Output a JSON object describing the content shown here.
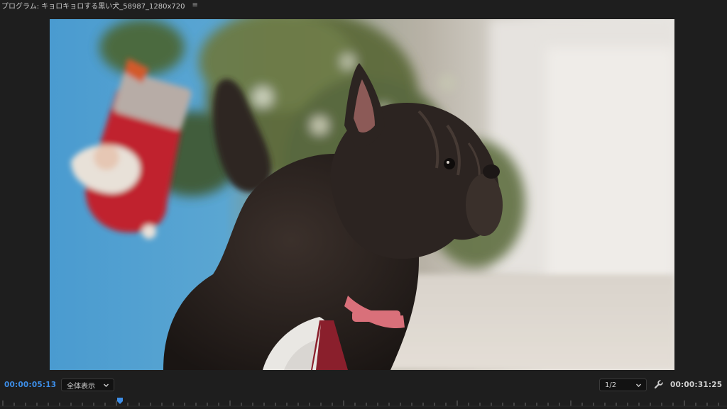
{
  "panel": {
    "title": "プログラム: キョロキョロする黒い犬_58987_1280x720",
    "menu_icon": "hamburger-menu-icon"
  },
  "video": {
    "description_icon": "video-preview",
    "colors": {
      "sky_blue": "#4f9fd0",
      "tree_green": "#5c6a38",
      "dog_black": "#231d1a",
      "stocking_red": "#c0242e",
      "collar_pink": "#d9707a"
    }
  },
  "controls": {
    "current_timecode": "00:00:05:13",
    "zoom_value": "全体表示",
    "resolution_value": "1/2",
    "duration_timecode": "00:00:31:25",
    "timecode_color": "#3d8ee8",
    "playhead_color": "#3d8ee8"
  },
  "ruler": {
    "playhead_icon": "playhead-marker-icon",
    "playhead_position_fraction": 0.165
  }
}
